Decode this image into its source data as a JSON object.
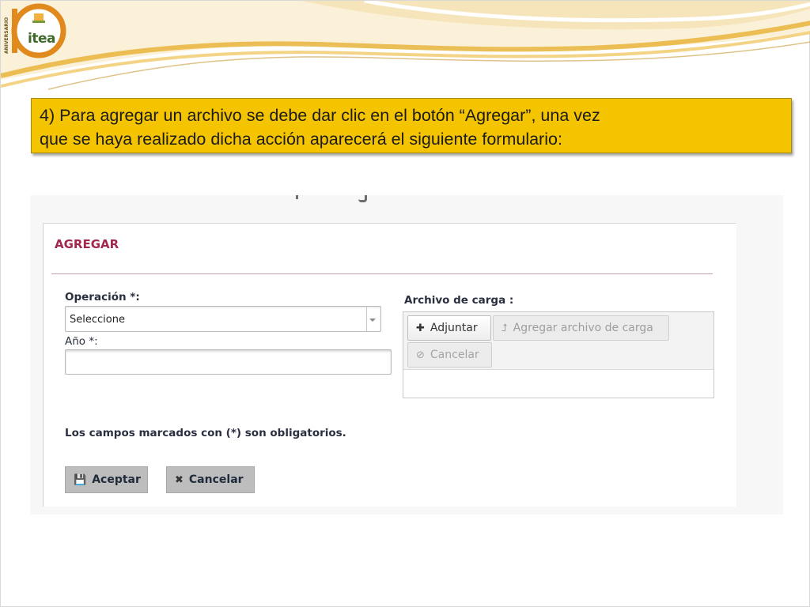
{
  "logo": {
    "text": "itea",
    "side_text": "ANIVERSARIO",
    "number": "10"
  },
  "instruction": {
    "line1": "4) Para agregar un archivo se debe dar clic en el botón “Agregar”, una vez",
    "line2": "que se haya realizado dicha acción aparecerá el siguiente formulario:"
  },
  "form": {
    "title": "AGREGAR",
    "operacion_label": "Operación *:",
    "operacion_value": "Seleccione",
    "anio_label": "Año *:",
    "anio_value": "",
    "archivo_label": "Archivo de carga :",
    "adjuntar_label": "Adjuntar",
    "agregar_archivo_label": "Agregar archivo de carga",
    "upload_cancel_label": "Cancelar",
    "required_note": "Los campos marcados con (*) son obligatorios.",
    "aceptar_label": "Aceptar",
    "cancelar_label": "Cancelar"
  },
  "colors": {
    "instruction_bg": "#f5c400",
    "title": "#a3284d",
    "header_gold": "#e8b43a"
  },
  "icons": {
    "adjuntar": "plus-icon",
    "agregar_archivo": "upload-arrow-icon",
    "upload_cancel": "cancel-circle-icon",
    "aceptar": "save-disk-icon",
    "cancelar": "close-x-icon"
  }
}
